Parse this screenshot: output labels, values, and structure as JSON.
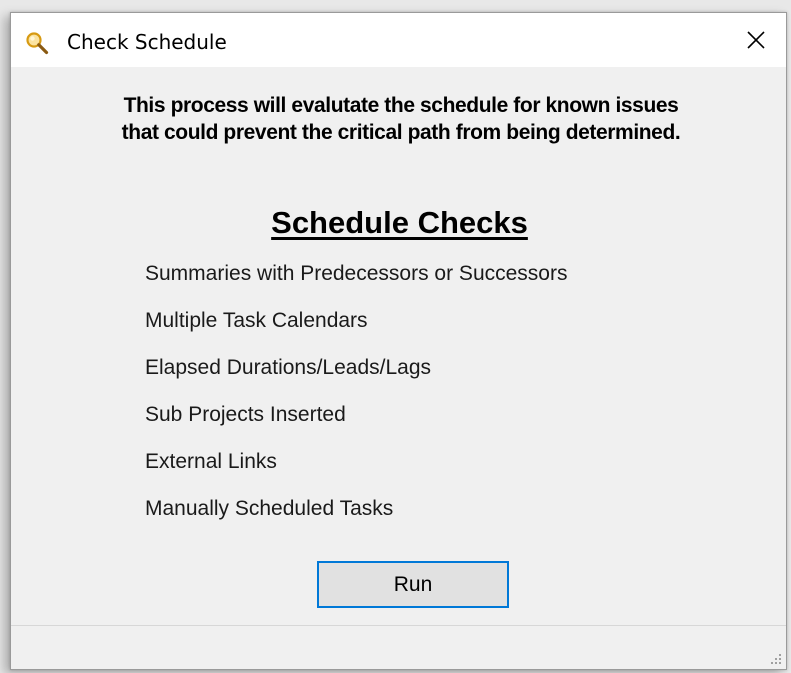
{
  "window": {
    "title": "Check Schedule",
    "title_icon": "magnifier-icon",
    "close_icon": "close-icon"
  },
  "intro": {
    "line1": "This process will evalutate the schedule for known issues",
    "line2": "that could prevent the critical path from being determined."
  },
  "checks": {
    "heading": "Schedule Checks",
    "items": [
      "Summaries with Predecessors or Successors",
      "Multiple Task Calendars",
      "Elapsed Durations/Leads/Lags",
      "Sub Projects Inserted",
      "External Links",
      "Manually Scheduled Tasks"
    ]
  },
  "actions": {
    "run_label": "Run"
  },
  "colors": {
    "button_focus_border": "#0078d7",
    "icon_lens": "#f3c23a"
  }
}
